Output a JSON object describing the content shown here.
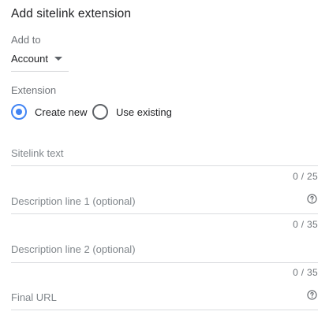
{
  "panel": {
    "title": "Add sitelink extension"
  },
  "add_to": {
    "label": "Add to",
    "selected": "Account"
  },
  "extension": {
    "label": "Extension",
    "options": [
      {
        "label": "Create new",
        "checked": true
      },
      {
        "label": "Use existing",
        "checked": false
      }
    ]
  },
  "fields": {
    "sitelink_text": {
      "placeholder": "Sitelink text",
      "counter": "0 / 25"
    },
    "description_1": {
      "placeholder": "Description line 1 (optional)",
      "counter": "0 / 35",
      "icon": "help-circle-icon"
    },
    "description_2": {
      "placeholder": "Description line 2 (optional)",
      "counter": "0 / 35"
    },
    "final_url": {
      "placeholder": "Final URL",
      "icon": "help-circle-icon"
    }
  },
  "colors": {
    "accent": "#4285f4",
    "text": "#202124",
    "muted": "#6f7378",
    "divider": "#dadce0"
  }
}
